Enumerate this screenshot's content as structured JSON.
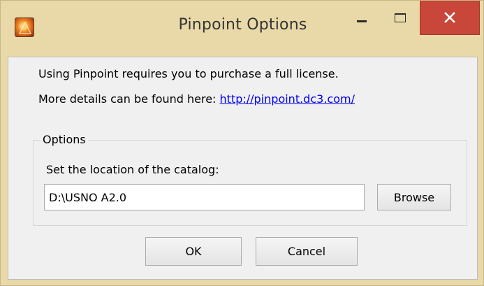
{
  "window": {
    "title": "Pinpoint Options",
    "app_icon": "pinpoint-app-icon",
    "controls": {
      "minimize_icon": "minimize-icon",
      "maximize_icon": "maximize-icon",
      "close_icon": "close-icon",
      "close_color": "#c8463a"
    }
  },
  "body": {
    "intro": "Using Pinpoint requires you to purchase a full license.",
    "details_prefix": "More details can be found here: ",
    "link_text": "http://pinpoint.dc3.com/"
  },
  "options_group": {
    "legend": "Options",
    "catalog_label": "Set the location of the catalog:",
    "catalog_value": "D:\\USNO A2.0",
    "browse_label": "Browse"
  },
  "buttons": {
    "ok_label": "OK",
    "cancel_label": "Cancel"
  },
  "colors": {
    "frame": "#e9d9a8",
    "client_bg": "#f0f0f0",
    "link": "#0000ee"
  }
}
